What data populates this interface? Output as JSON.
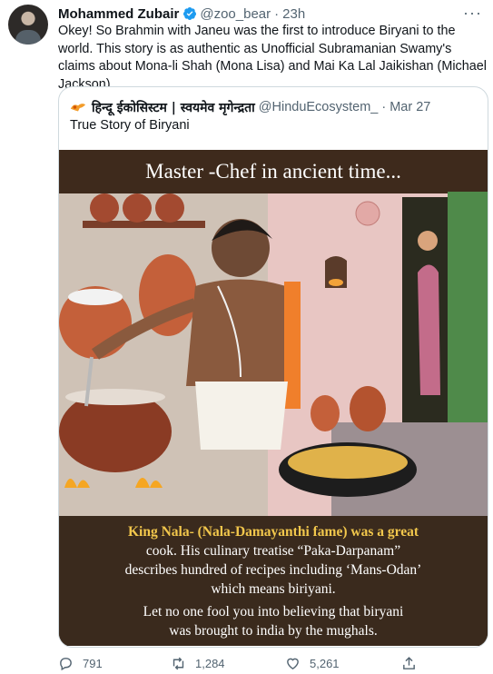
{
  "author": {
    "name": "Mohammed Zubair",
    "handle": "@zoo_bear",
    "separator": "·",
    "time": "23h"
  },
  "more_label": "···",
  "tweet_text": "Okey! So Brahmin with Janeu was the first to introduce Biryani to the world. This story is as authentic as Unofficial Subramanian Swamy's claims about Mona-li Shah (Mona Lisa) and Mai Ka Lal Jaikishan (Michael Jackson).",
  "quoted": {
    "name": "हिन्दू ईकोसिस्टम | स्वयमेव मृगेन्द्रता",
    "handle": "@HinduEcosystem_",
    "separator": "·",
    "date": "Mar 27",
    "text": "True Story of Biryani",
    "image": {
      "title": "Master -Chef in ancient time...",
      "caption_line1": "King Nala- (Nala-Damayanthi fame) was a great",
      "caption_line2": "cook. His culinary treatise “Paka-Darpanam”",
      "caption_line3": "describes hundred of recipes including ‘Mans-Odan’",
      "caption_line4": "which means biriyani.",
      "caption_line5": "Let no one fool you into believing that biryani",
      "caption_line6": "was brought to india by the mughals."
    }
  },
  "actions": {
    "replies": "791",
    "retweets": "1,284",
    "likes": "5,261"
  },
  "colors": {
    "verified": "#1d9bf0",
    "secondary_text": "#536471",
    "caption_highlight": "#f2c74c",
    "caption_text": "#ffffff"
  },
  "icons": [
    "verified-badge-icon",
    "more-icon",
    "reply-icon",
    "retweet-icon",
    "like-icon",
    "share-icon"
  ]
}
